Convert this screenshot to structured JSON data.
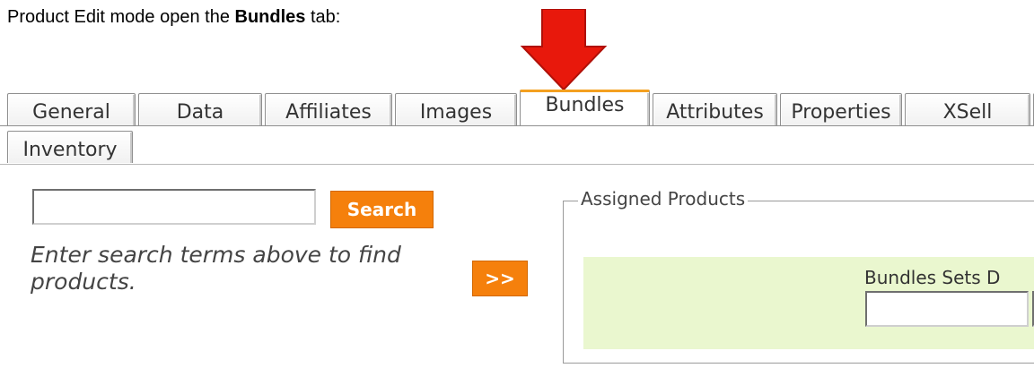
{
  "intro": {
    "prefix": "Product Edit mode open the ",
    "bold": "Bundles",
    "suffix": " tab:"
  },
  "colors": {
    "accent_orange": "#f5800c",
    "arrow_red": "#e8180c",
    "panel_green": "#eaf7cf",
    "active_tab_top": "#f4a020"
  },
  "tabs_row1": [
    {
      "label": "General"
    },
    {
      "label": "Data"
    },
    {
      "label": "Affiliates"
    },
    {
      "label": "Images"
    },
    {
      "label": "Bundles",
      "active": true
    },
    {
      "label": "Attributes"
    },
    {
      "label": "Properties"
    },
    {
      "label": "XSell"
    }
  ],
  "tabs_row2": [
    {
      "label": "Inventory"
    }
  ],
  "search": {
    "value": "",
    "button_label": "Search",
    "hint": "Enter search terms above to find products."
  },
  "move_button_label": ">>",
  "assigned": {
    "legend": "Assigned Products",
    "sets_label": "Bundles Sets D",
    "sets_value": ""
  }
}
